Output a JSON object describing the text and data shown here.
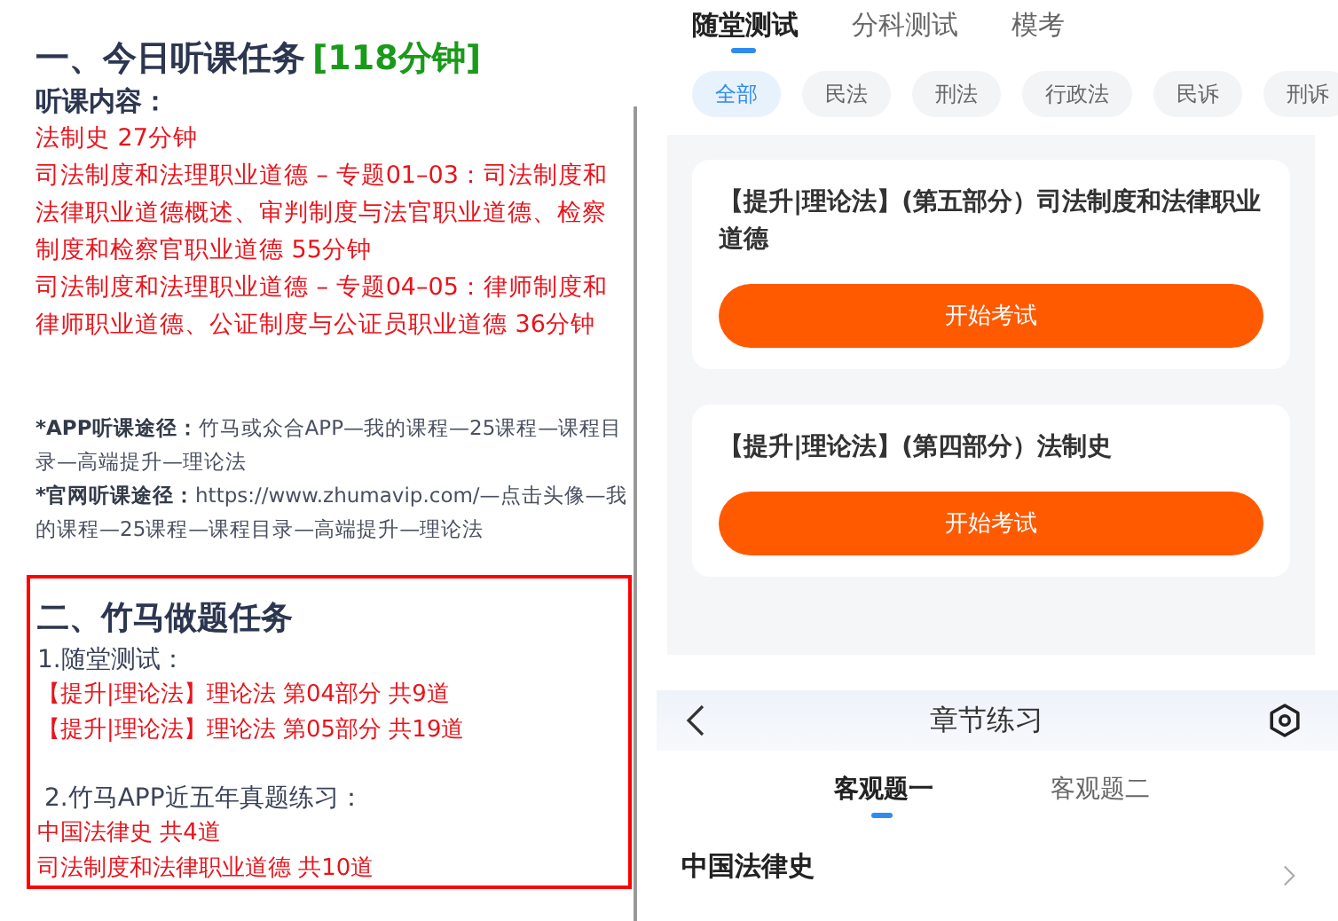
{
  "notes": {
    "section1": {
      "title": "一、今日听课任务",
      "duration": "[118分钟]",
      "subheading": "听课内容：",
      "lessons": [
        "法制史 27分钟",
        "司法制度和法理职业道德 – 专题01–03：司法制度和法律职业道德概述、审判制度与法官职业道德、检察制度和检察官职业道德 55分钟",
        "司法制度和法理职业道德 – 专题04–05：律师制度和律师职业道德、公证制度与公证员职业道德 36分钟"
      ]
    },
    "routes": [
      {
        "label": "*APP听课途径：",
        "text": "竹马或众合APP—我的课程—25课程—课程目录—高端提升—理论法"
      },
      {
        "label": "*官网听课途径：",
        "text": "https://www.zhumavip.com/—点击头像—我的课程—25课程—课程目录—高端提升—理论法"
      }
    ],
    "section2": {
      "title": "二、竹马做题任务",
      "groups": [
        {
          "heading": "1.随堂测试：",
          "items": [
            "【提升|理论法】理论法 第04部分 共9道",
            "【提升|理论法】理论法 第05部分 共19道"
          ]
        },
        {
          "heading": "2.竹马APP近五年真题练习：",
          "items": [
            "中国法律史 共4道",
            "司法制度和法律职业道德 共10道"
          ]
        }
      ]
    }
  },
  "quiz_screen": {
    "tabs": [
      {
        "label": "随堂测试",
        "selected": true
      },
      {
        "label": "分科测试",
        "selected": false
      },
      {
        "label": "模考",
        "selected": false
      }
    ],
    "filters": [
      {
        "label": "全部",
        "selected": true
      },
      {
        "label": "民法",
        "selected": false
      },
      {
        "label": "刑法",
        "selected": false
      },
      {
        "label": "行政法",
        "selected": false
      },
      {
        "label": "民诉",
        "selected": false
      },
      {
        "label": "刑诉",
        "selected": false
      }
    ],
    "cards": [
      {
        "title": "【提升|理论法】(第五部分）司法制度和法律职业道德",
        "button": "开始考试"
      },
      {
        "title": "【提升|理论法】(第四部分）法制史",
        "button": "开始考试"
      }
    ]
  },
  "chapter_screen": {
    "title": "章节练习",
    "tabs": [
      {
        "label": "客观题一",
        "selected": true
      },
      {
        "label": "客观题二",
        "selected": false
      }
    ],
    "items": [
      "中国法律史"
    ]
  }
}
